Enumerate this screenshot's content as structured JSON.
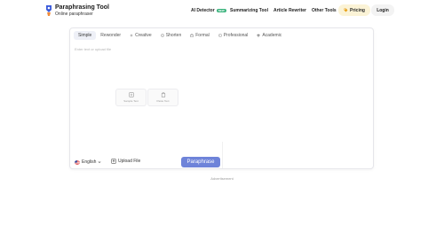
{
  "brand": {
    "title": "Paraphrasing Tool",
    "subtitle": "Online paraphraser"
  },
  "nav": {
    "ai_detector": "AI Detector",
    "ai_badge": "NEW",
    "summarizing": "Summarizing Tool",
    "article_rewriter": "Article Rewriter",
    "other_tools": "Other Tools",
    "pricing": "Pricing",
    "login": "Login"
  },
  "modes": [
    {
      "label": "Simple",
      "icon": "none",
      "active": true
    },
    {
      "label": "Rewonder",
      "icon": "none",
      "active": false
    },
    {
      "label": "Creative",
      "icon": "sparkle-icon",
      "active": false
    },
    {
      "label": "Shorten",
      "icon": "compress-icon",
      "active": false
    },
    {
      "label": "Formal",
      "icon": "briefcase-icon",
      "active": false
    },
    {
      "label": "Professional",
      "icon": "id-card-icon",
      "active": false
    },
    {
      "label": "Academic",
      "icon": "graduation-cap-icon",
      "active": false
    }
  ],
  "editor": {
    "placeholder": "Enter text or upload file",
    "sample_text": "Sample Text",
    "paste_text": "Paste Text"
  },
  "footer": {
    "language": "English",
    "upload": "Upload File",
    "paraphrase": "Paraphrase"
  },
  "advertisement": "Advertisement",
  "colors": {
    "primary_button": "#6e83d9",
    "pricing_bg": "#fbf3d6",
    "badge_green": "#3bb37d"
  }
}
